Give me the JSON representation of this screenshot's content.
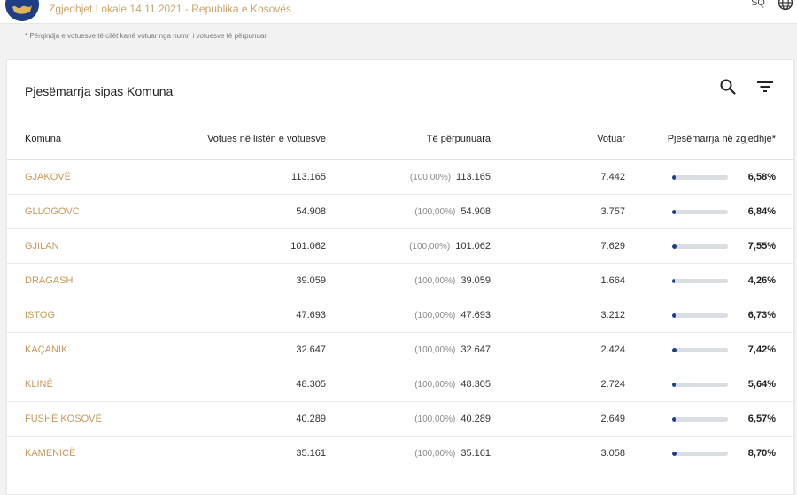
{
  "header": {
    "title": "Zgjedhjet Lokale 14.11.2021 - Republika e Kosovës",
    "language": "SQ"
  },
  "note": "* Përqindja e votuesve të cilët kanë votuar nga numri i votuesve të përpunuar",
  "card": {
    "title": "Pjesëmarrja sipas Komuna"
  },
  "columns": {
    "municipality": "Komuna",
    "registered": "Votues në listën e votuesve",
    "processed": "Të përpunuara",
    "voted": "Votuar",
    "turnout": "Pjesëmarrja në zgjedhje*"
  },
  "rows": [
    {
      "name": "GJAKOVË",
      "registered": "113.165",
      "processed_pct": "(100,00%)",
      "processed": "113.165",
      "voted": "7.442",
      "turnout": "6,58%",
      "turnout_value": 6.58
    },
    {
      "name": "GLLOGOVC",
      "registered": "54.908",
      "processed_pct": "(100,00%)",
      "processed": "54.908",
      "voted": "3.757",
      "turnout": "6,84%",
      "turnout_value": 6.84
    },
    {
      "name": "GJILAN",
      "registered": "101.062",
      "processed_pct": "(100,00%)",
      "processed": "101.062",
      "voted": "7.629",
      "turnout": "7,55%",
      "turnout_value": 7.55
    },
    {
      "name": "DRAGASH",
      "registered": "39.059",
      "processed_pct": "(100,00%)",
      "processed": "39.059",
      "voted": "1.664",
      "turnout": "4,26%",
      "turnout_value": 4.26
    },
    {
      "name": "ISTOG",
      "registered": "47.693",
      "processed_pct": "(100,00%)",
      "processed": "47.693",
      "voted": "3.212",
      "turnout": "6,73%",
      "turnout_value": 6.73
    },
    {
      "name": "KAÇANIK",
      "registered": "32.647",
      "processed_pct": "(100,00%)",
      "processed": "32.647",
      "voted": "2.424",
      "turnout": "7,42%",
      "turnout_value": 7.42
    },
    {
      "name": "KLINË",
      "registered": "48.305",
      "processed_pct": "(100,00%)",
      "processed": "48.305",
      "voted": "2.724",
      "turnout": "5,64%",
      "turnout_value": 5.64
    },
    {
      "name": "FUSHË KOSOVË",
      "registered": "40.289",
      "processed_pct": "(100,00%)",
      "processed": "40.289",
      "voted": "2.649",
      "turnout": "6,57%",
      "turnout_value": 6.57
    },
    {
      "name": "KAMENICË",
      "registered": "35.161",
      "processed_pct": "(100,00%)",
      "processed": "35.161",
      "voted": "3.058",
      "turnout": "8,70%",
      "turnout_value": 8.7
    }
  ],
  "colors": {
    "accent": "#c49a5c",
    "bar_fill": "#1f3f84",
    "bar_track": "#dadde2"
  },
  "icons": {
    "logo": "kosovo-emblem-icon",
    "language": "globe-icon",
    "search": "search-icon",
    "filter": "filter-icon"
  }
}
